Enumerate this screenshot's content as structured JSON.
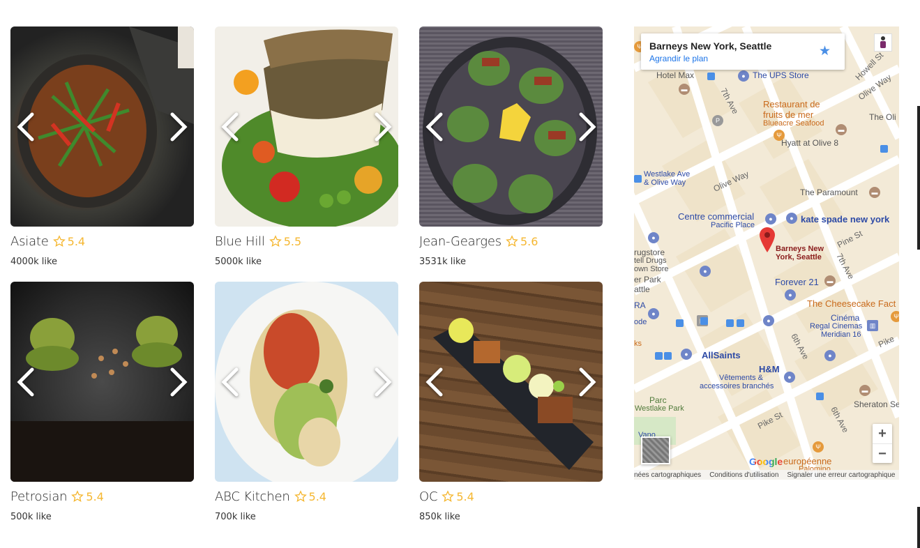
{
  "restaurants": [
    {
      "name": "Asiate",
      "rating": "5.4",
      "likes": "4000k like",
      "photo": "dark clay pot with stir-fried vegetables"
    },
    {
      "name": "Blue Hill",
      "rating": "5.5",
      "likes": "5000k like",
      "photo": "grilled fish on salad"
    },
    {
      "name": "Jean-Gearges",
      "rating": "5.6",
      "likes": "3531k like",
      "photo": "baked oysters on platter"
    },
    {
      "name": "Petrosian",
      "rating": "5.4",
      "likes": "500k like",
      "photo": "green macarons on slate"
    },
    {
      "name": "ABC Kitchen",
      "rating": "5.4",
      "likes": "700k like",
      "photo": "stuffed pastry in white bowl"
    },
    {
      "name": "OC",
      "rating": "5.4",
      "likes": "850k like",
      "photo": "appetizers on long dark plate"
    }
  ],
  "map": {
    "place_title": "Barneys New York, Seattle",
    "place_link": "Agrandir le plan",
    "zoom_in": "+",
    "zoom_out": "−",
    "google": "Google",
    "footer": [
      "nées cartographiques",
      "Conditions d'utilisation",
      "Signaler une erreur cartographique"
    ],
    "labels": {
      "hotel_max": "Hotel Max",
      "ups": "The UPS Store",
      "restaurant_fruits": "Restaurant de",
      "restaurant_fruits2": "fruits de mer",
      "blueacre": "Blueacre Seafood",
      "hyatt": "Hyatt at Olive 8",
      "the_oli": "The Oli",
      "westlake_ave": "Westlake Ave",
      "olive_way_stop": "& Olive Way",
      "olive_way": "Olive Way",
      "paramount": "The Paramount",
      "centre_commercial": "Centre commercial",
      "pacific_place": "Pacific Place",
      "kate_spade": "kate spade new york",
      "barneys_pin": "Barneys New",
      "barneys_pin2": "York, Seattle",
      "pine_st": "Pine St",
      "forever21": "Forever 21",
      "cheesecake": "The Cheesecake Fact",
      "cinema": "Cinéma",
      "regal": "Regal Cinemas",
      "meridian": "Meridian 16",
      "allsaints": "AllSaints",
      "hm": "H&M",
      "hm_desc": "Vêtements &",
      "hm_desc2": "accessoires branchés",
      "parc": "Parc",
      "westlake_park": "Westlake Park",
      "pike_st": "Pike St",
      "sheraton": "Sheraton Se",
      "europeenne": "européenne",
      "sixth_ave": "6th Ave",
      "sixth_ave2": "6th Ave",
      "seventh_ave": "7th Ave",
      "seventh_ave2": "7th Ave",
      "howell": "Howell St",
      "olive_way2": "Olive Way",
      "pike_right": "Pike",
      "drugstore": "rugstore",
      "drugs": "tell Drugs",
      "own_store": "own Store",
      "er_park": "er Park",
      "attle": "attle",
      "ra": "RA",
      "ode": "ode",
      "ks": "ks",
      "vano": "Vano",
      "palomino": "Palomino"
    }
  },
  "colors": {
    "accent_star": "#f5b731",
    "map_bg": "#f3ead7",
    "link_blue": "#1a73e8"
  }
}
